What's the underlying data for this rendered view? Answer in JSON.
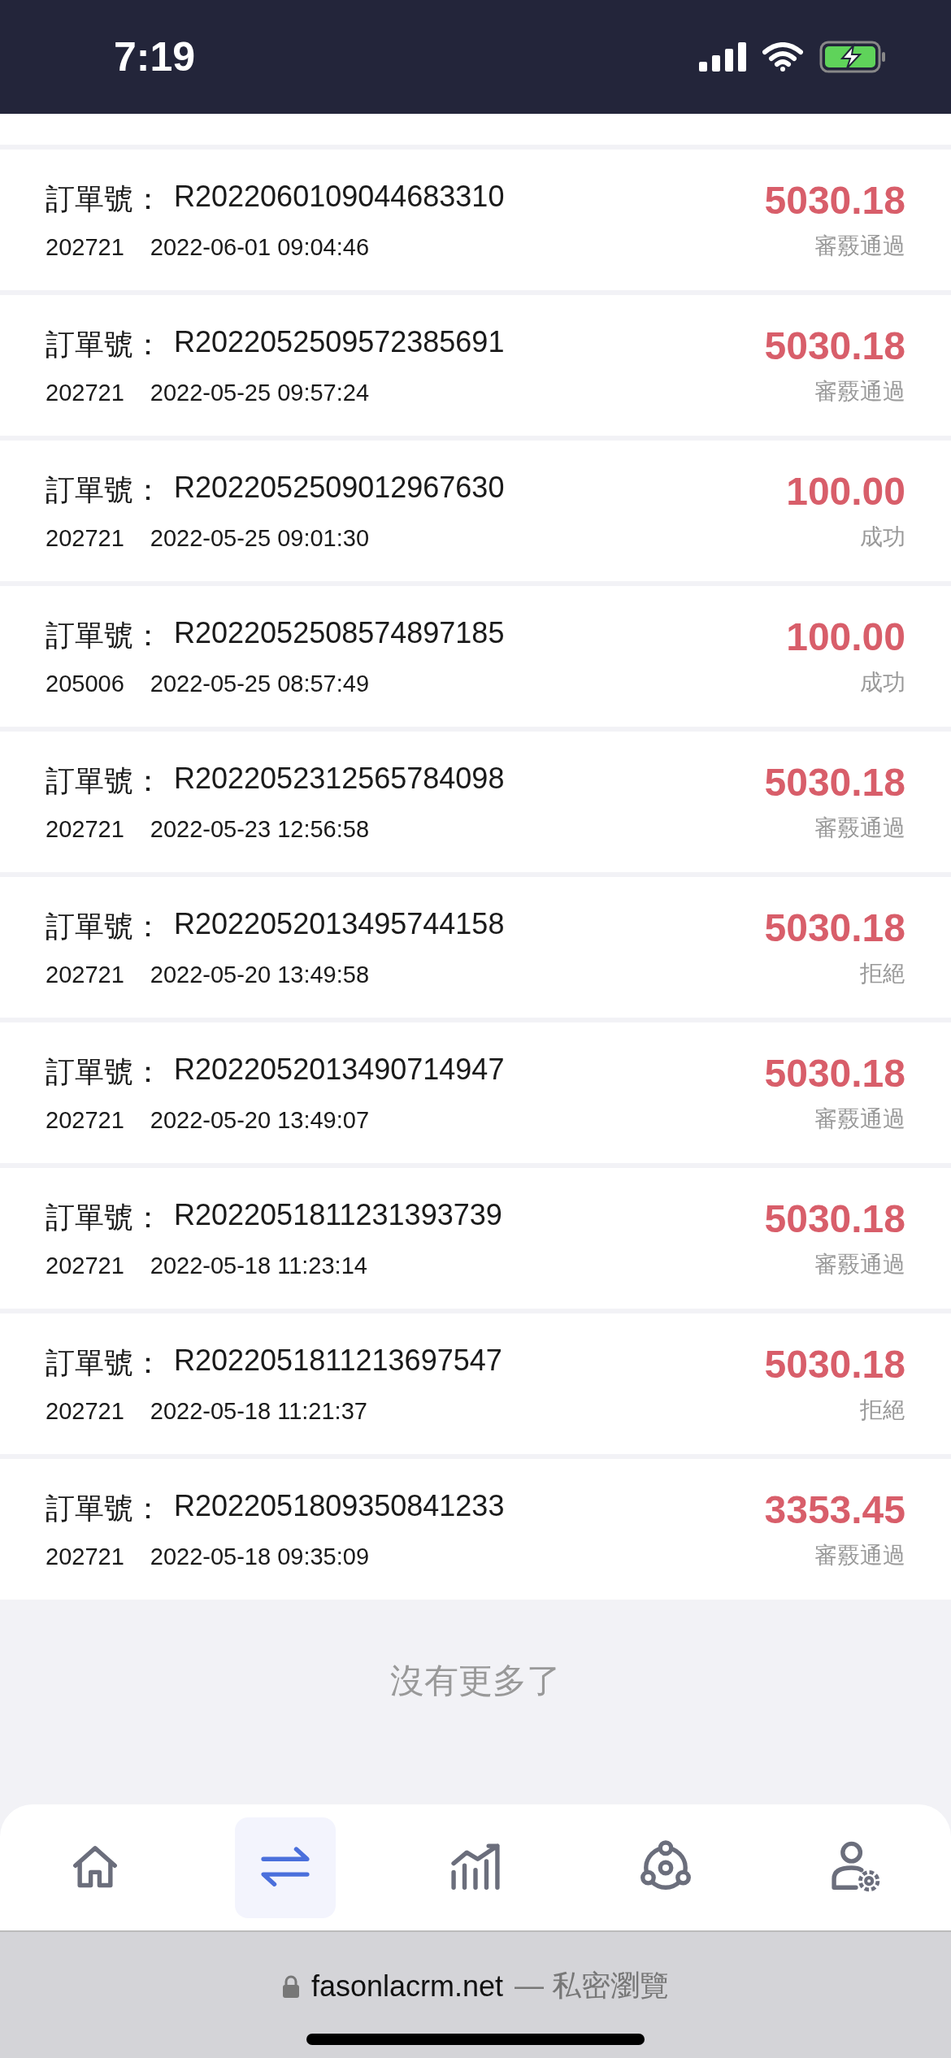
{
  "status_bar": {
    "time": "7:19"
  },
  "orders": [
    {
      "label": "訂單號：",
      "number": "R2022060109044683310",
      "user": "202721",
      "datetime": "2022-06-01 09:04:46",
      "amount": "5030.18",
      "status": "審覈通過"
    },
    {
      "label": "訂單號：",
      "number": "R2022052509572385691",
      "user": "202721",
      "datetime": "2022-05-25 09:57:24",
      "amount": "5030.18",
      "status": "審覈通過"
    },
    {
      "label": "訂單號：",
      "number": "R2022052509012967630",
      "user": "202721",
      "datetime": "2022-05-25 09:01:30",
      "amount": "100.00",
      "status": "成功"
    },
    {
      "label": "訂單號：",
      "number": "R2022052508574897185",
      "user": "205006",
      "datetime": "2022-05-25 08:57:49",
      "amount": "100.00",
      "status": "成功"
    },
    {
      "label": "訂單號：",
      "number": "R2022052312565784098",
      "user": "202721",
      "datetime": "2022-05-23 12:56:58",
      "amount": "5030.18",
      "status": "審覈通過"
    },
    {
      "label": "訂單號：",
      "number": "R2022052013495744158",
      "user": "202721",
      "datetime": "2022-05-20 13:49:58",
      "amount": "5030.18",
      "status": "拒絕"
    },
    {
      "label": "訂單號：",
      "number": "R2022052013490714947",
      "user": "202721",
      "datetime": "2022-05-20 13:49:07",
      "amount": "5030.18",
      "status": "審覈通過"
    },
    {
      "label": "訂單號：",
      "number": "R2022051811231393739",
      "user": "202721",
      "datetime": "2022-05-18 11:23:14",
      "amount": "5030.18",
      "status": "審覈通過"
    },
    {
      "label": "訂單號：",
      "number": "R2022051811213697547",
      "user": "202721",
      "datetime": "2022-05-18 11:21:37",
      "amount": "5030.18",
      "status": "拒絕"
    },
    {
      "label": "訂單號：",
      "number": "R2022051809350841233",
      "user": "202721",
      "datetime": "2022-05-18 09:35:09",
      "amount": "3353.45",
      "status": "審覈通過"
    }
  ],
  "end_message": "沒有更多了",
  "tab_bar": [
    {
      "kind": "home",
      "selected": false
    },
    {
      "kind": "transfer",
      "selected": true
    },
    {
      "kind": "chart",
      "selected": false
    },
    {
      "kind": "network",
      "selected": false
    },
    {
      "kind": "user-settings",
      "selected": false
    }
  ],
  "browser_bar": {
    "url": "fasonlacrm.net",
    "mode": "— 私密瀏覽"
  }
}
